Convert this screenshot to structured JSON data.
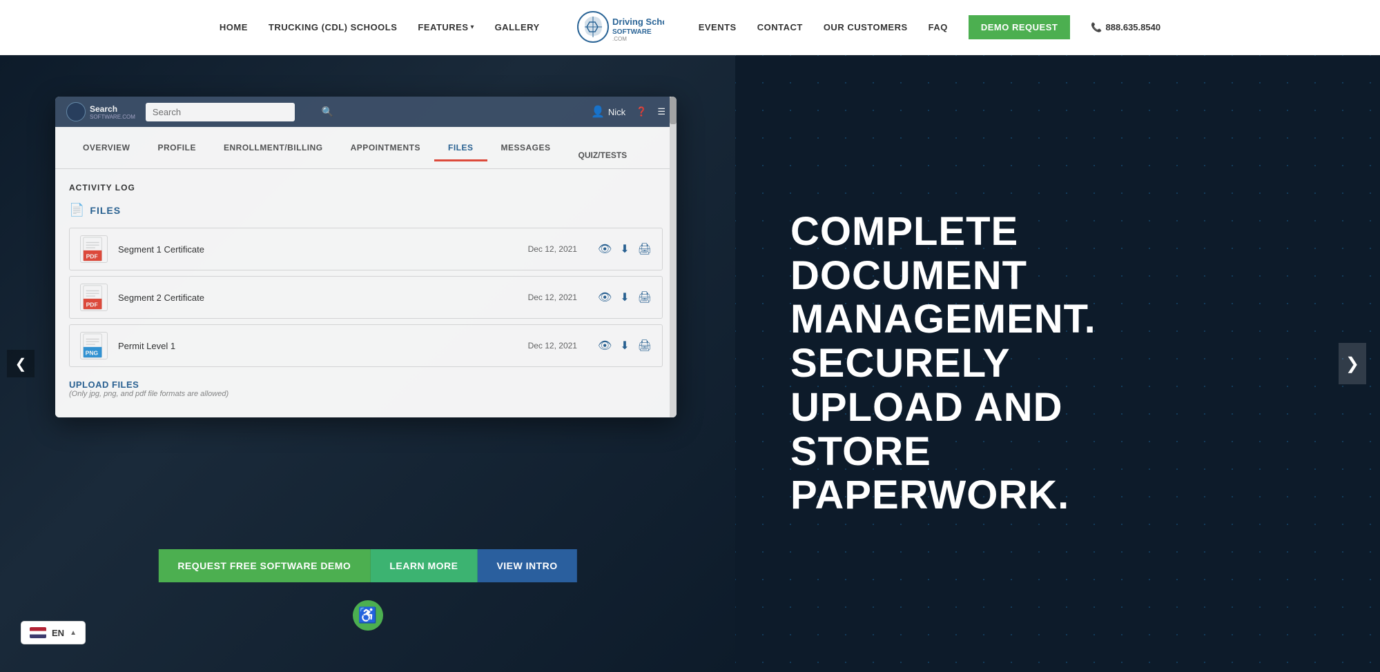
{
  "navbar": {
    "links": [
      {
        "label": "HOME",
        "id": "home"
      },
      {
        "label": "TRUCKING (CDL) SCHOOLS",
        "id": "trucking"
      },
      {
        "label": "FEATURES",
        "id": "features",
        "hasDropdown": true
      },
      {
        "label": "GALLERY",
        "id": "gallery"
      },
      {
        "label": "EVENTS",
        "id": "events"
      },
      {
        "label": "CONTACT",
        "id": "contact"
      },
      {
        "label": "OUR CUSTOMERS",
        "id": "our-customers"
      },
      {
        "label": "FAQ",
        "id": "faq"
      }
    ],
    "logo": {
      "line1": "Driving School",
      "line2": "SOFTWARE.COM"
    },
    "demo_button": "DEMO REQUEST",
    "phone": "888.635.8540"
  },
  "software": {
    "search_placeholder": "Search",
    "user_name": "Nick",
    "tabs": [
      {
        "label": "OVERVIEW",
        "active": false
      },
      {
        "label": "PROFILE",
        "active": false
      },
      {
        "label": "ENROLLMENT/BILLING",
        "active": false
      },
      {
        "label": "APPOINTMENTS",
        "active": false
      },
      {
        "label": "FILES",
        "active": true
      },
      {
        "label": "MESSAGES",
        "active": false
      }
    ],
    "tab_extra": "QUIZ/TESTS",
    "activity_log_label": "ACTIVITY LOG",
    "files_section_label": "FILES",
    "file_rows": [
      {
        "name": "Segment 1 Certificate",
        "date": "Dec 12, 2021",
        "type": "PDF"
      },
      {
        "name": "Segment 2 Certificate",
        "date": "Dec 12, 2021",
        "type": "PDF"
      },
      {
        "name": "Permit Level 1",
        "date": "Dec 12, 2021",
        "type": "PNG"
      }
    ],
    "upload_title": "UPLOAD FILES",
    "upload_sub": "(Only jpg, png, and pdf file formats are allowed)"
  },
  "cta": {
    "request_label": "REQUEST FREE SOFTWARE DEMO",
    "learn_label": "LEARN MORE",
    "intro_label": "VIEW INTRO"
  },
  "headline": {
    "line1": "COMPLETE",
    "line2": "DOCUMENT",
    "line3": "MANAGEMENT.",
    "line4": "SECURELY",
    "line5": "UPLOAD AND",
    "line6": "STORE",
    "line7": "PAPERWORK."
  },
  "lang": {
    "code": "EN"
  },
  "carousel": {
    "left_arrow": "❮",
    "right_arrow": "❯"
  }
}
